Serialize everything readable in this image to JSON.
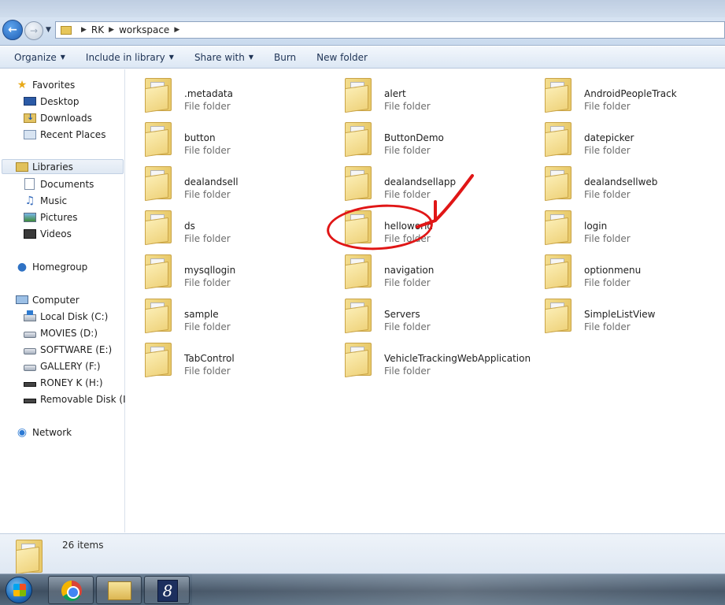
{
  "address_bar": {
    "crumbs": [
      "RK",
      "workspace"
    ]
  },
  "toolbar": {
    "organize": "Organize",
    "include_in_library": "Include in library",
    "share_with": "Share with",
    "burn": "Burn",
    "new_folder": "New folder"
  },
  "nav": {
    "favorites": "Favorites",
    "desktop": "Desktop",
    "downloads": "Downloads",
    "recent_places": "Recent Places",
    "libraries": "Libraries",
    "documents": "Documents",
    "music": "Music",
    "pictures": "Pictures",
    "videos": "Videos",
    "homegroup": "Homegroup",
    "computer": "Computer",
    "local_disk": "Local Disk (C:)",
    "movies": "MOVIES (D:)",
    "software": "SOFTWARE (E:)",
    "gallery": "GALLERY (F:)",
    "roney": "RONEY K (H:)",
    "removable": "Removable Disk (I:)",
    "network": "Network"
  },
  "files": [
    {
      "name": ".metadata",
      "type": "File folder"
    },
    {
      "name": "alert",
      "type": "File folder"
    },
    {
      "name": "AndroidPeopleTrack",
      "type": "File folder"
    },
    {
      "name": "button",
      "type": "File folder"
    },
    {
      "name": "ButtonDemo",
      "type": "File folder"
    },
    {
      "name": "datepicker",
      "type": "File folder"
    },
    {
      "name": "dealandsell",
      "type": "File folder"
    },
    {
      "name": "dealandsellapp",
      "type": "File folder"
    },
    {
      "name": "dealandsellweb",
      "type": "File folder"
    },
    {
      "name": "ds",
      "type": "File folder"
    },
    {
      "name": "helloworld",
      "type": "File folder"
    },
    {
      "name": "login",
      "type": "File folder"
    },
    {
      "name": "mysqllogin",
      "type": "File folder"
    },
    {
      "name": "navigation",
      "type": "File folder"
    },
    {
      "name": "optionmenu",
      "type": "File folder"
    },
    {
      "name": "sample",
      "type": "File folder"
    },
    {
      "name": "Servers",
      "type": "File folder"
    },
    {
      "name": "SimpleListView",
      "type": "File folder"
    },
    {
      "name": "TabControl",
      "type": "File folder"
    },
    {
      "name": "VehicleTrackingWebApplication",
      "type": "File folder"
    }
  ],
  "details": {
    "count": "26 items"
  },
  "colors": {
    "annotation": "#e01616",
    "toolbar_text": "#1e3355"
  },
  "icons": [
    "back-arrow-icon",
    "forward-arrow-icon",
    "folder-icon",
    "star-icon",
    "start-orb-icon",
    "chrome-icon",
    "explorer-icon",
    "app-8-icon"
  ]
}
